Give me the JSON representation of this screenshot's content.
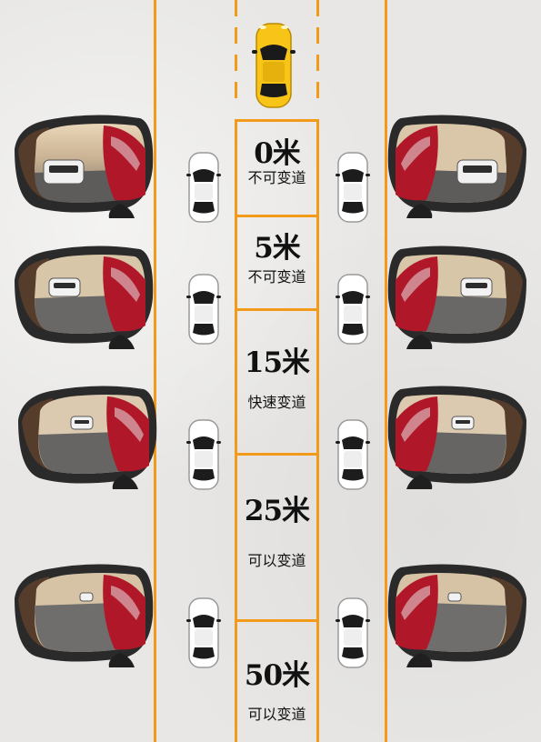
{
  "colors": {
    "lane_line": "#f29a1a",
    "subject_car": "#f7c417",
    "other_car": "#ffffff",
    "mirror_body": "#222222"
  },
  "icons": {
    "top_car": "yellow-car-icon",
    "lane_cars": "white-car-icon",
    "mirrors": "side-mirror-icon"
  },
  "segments": [
    {
      "distance": "0米",
      "advice": "不可变道"
    },
    {
      "distance": "5米",
      "advice": "不可变道"
    },
    {
      "distance": "15米",
      "advice": "快速变道"
    },
    {
      "distance": "25米",
      "advice": "可以变道"
    },
    {
      "distance": "50米",
      "advice": "可以变道"
    }
  ]
}
